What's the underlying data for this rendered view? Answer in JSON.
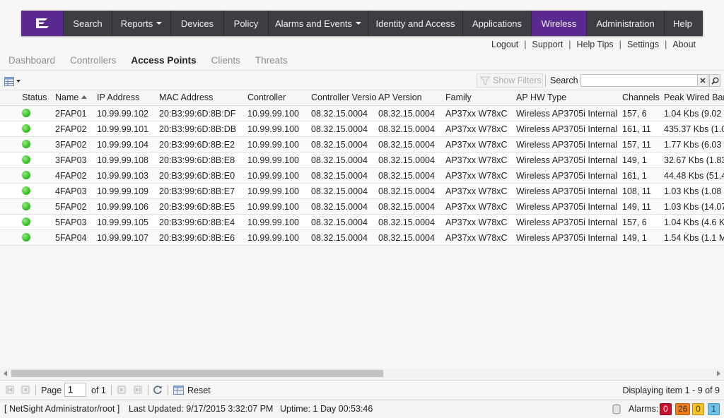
{
  "nav": {
    "items": [
      {
        "label": "Search",
        "caret": false
      },
      {
        "label": "Reports",
        "caret": true
      },
      {
        "label": "Devices",
        "caret": false
      },
      {
        "label": "Policy",
        "caret": false
      },
      {
        "label": "Alarms and Events",
        "caret": true
      },
      {
        "label": "Identity and Access",
        "caret": false
      },
      {
        "label": "Applications",
        "caret": false
      },
      {
        "label": "Wireless",
        "caret": false,
        "active": true
      },
      {
        "label": "Administration",
        "caret": false
      },
      {
        "label": "Help",
        "caret": false
      }
    ],
    "accent": "#5a2a8e"
  },
  "util_links": [
    "Logout",
    "Support",
    "Help Tips",
    "Settings",
    "About"
  ],
  "subtabs": [
    {
      "label": "Dashboard",
      "active": false
    },
    {
      "label": "Controllers",
      "active": false
    },
    {
      "label": "Access Points",
      "active": true
    },
    {
      "label": "Clients",
      "active": false
    },
    {
      "label": "Threats",
      "active": false
    }
  ],
  "toolbar": {
    "show_filters": "Show Filters",
    "search_label": "Search",
    "search_value": ""
  },
  "table": {
    "columns": [
      "Status",
      "Name",
      "IP Address",
      "MAC Address",
      "Controller",
      "Controller Versio",
      "AP Version",
      "Family",
      "AP HW Type",
      "Channels",
      "Peak Wired Band"
    ],
    "rows": [
      {
        "status": "up",
        "name": "2FAP01",
        "ip": "10.99.99.102",
        "mac": "20:B3:99:6D:8B:DF",
        "controller": "10.99.99.100",
        "controller_version": "08.32.15.0004",
        "ap_version": "08.32.15.0004",
        "family": "AP37xx W78xC",
        "hw_type": "Wireless AP3705i Internal",
        "channels": "157, 6",
        "peak": "1.04 Kbs (9.02"
      },
      {
        "status": "up",
        "name": "2FAP02",
        "ip": "10.99.99.101",
        "mac": "20:B3:99:6D:8B:DB",
        "controller": "10.99.99.100",
        "controller_version": "08.32.15.0004",
        "ap_version": "08.32.15.0004",
        "family": "AP37xx W78xC",
        "hw_type": "Wireless AP3705i Internal",
        "channels": "161, 11",
        "peak": "435.37 Kbs (1.0"
      },
      {
        "status": "up",
        "name": "3FAP02",
        "ip": "10.99.99.104",
        "mac": "20:B3:99:6D:8B:E2",
        "controller": "10.99.99.100",
        "controller_version": "08.32.15.0004",
        "ap_version": "08.32.15.0004",
        "family": "AP37xx W78xC",
        "hw_type": "Wireless AP3705i Internal",
        "channels": "157, 11",
        "peak": "1.77 Kbs (6.03"
      },
      {
        "status": "up",
        "name": "3FAP03",
        "ip": "10.99.99.108",
        "mac": "20:B3:99:6D:8B:E8",
        "controller": "10.99.99.100",
        "controller_version": "08.32.15.0004",
        "ap_version": "08.32.15.0004",
        "family": "AP37xx W78xC",
        "hw_type": "Wireless AP3705i Internal",
        "channels": "149, 1",
        "peak": "32.67 Kbs (1.83"
      },
      {
        "status": "up",
        "name": "4FAP02",
        "ip": "10.99.99.103",
        "mac": "20:B3:99:6D:8B:E0",
        "controller": "10.99.99.100",
        "controller_version": "08.32.15.0004",
        "ap_version": "08.32.15.0004",
        "family": "AP37xx W78xC",
        "hw_type": "Wireless AP3705i Internal",
        "channels": "161, 1",
        "peak": "44.48 Kbs (51.4"
      },
      {
        "status": "up",
        "name": "4FAP03",
        "ip": "10.99.99.109",
        "mac": "20:B3:99:6D:8B:E7",
        "controller": "10.99.99.100",
        "controller_version": "08.32.15.0004",
        "ap_version": "08.32.15.0004",
        "family": "AP37xx W78xC",
        "hw_type": "Wireless AP3705i Internal",
        "channels": "108, 11",
        "peak": "1.03 Kbs (1.08"
      },
      {
        "status": "up",
        "name": "5FAP02",
        "ip": "10.99.99.106",
        "mac": "20:B3:99:6D:8B:E5",
        "controller": "10.99.99.100",
        "controller_version": "08.32.15.0004",
        "ap_version": "08.32.15.0004",
        "family": "AP37xx W78xC",
        "hw_type": "Wireless AP3705i Internal",
        "channels": "149, 11",
        "peak": "1.03 Kbs (14.07"
      },
      {
        "status": "up",
        "name": "5FAP03",
        "ip": "10.99.99.105",
        "mac": "20:B3:99:6D:8B:E4",
        "controller": "10.99.99.100",
        "controller_version": "08.32.15.0004",
        "ap_version": "08.32.15.0004",
        "family": "AP37xx W78xC",
        "hw_type": "Wireless AP3705i Internal",
        "channels": "157, 6",
        "peak": "1.04 Kbs (4.6 K"
      },
      {
        "status": "up",
        "name": "5FAP04",
        "ip": "10.99.99.107",
        "mac": "20:B3:99:6D:8B:E6",
        "controller": "10.99.99.100",
        "controller_version": "08.32.15.0004",
        "ap_version": "08.32.15.0004",
        "family": "AP37xx W78xC",
        "hw_type": "Wireless AP3705i Internal",
        "channels": "149, 1",
        "peak": "1.54 Kbs (1.1 M"
      }
    ]
  },
  "paging": {
    "page_label": "Page",
    "page_value": "1",
    "of_label": "of 1",
    "reset_label": "Reset",
    "displaying": "Displaying item 1 - 9 of 9"
  },
  "status_bar": {
    "user": "[ NetSight Administrator/root ]",
    "updated": "Last Updated: 9/17/2015 3:32:07 PM",
    "uptime": "Uptime: 1 Day 00:53:46",
    "alarms_label": "Alarms:",
    "alarms": [
      {
        "count": "0",
        "bg": "#c8102e",
        "fg": "#ffffff",
        "border": "#8e0a1f"
      },
      {
        "count": "26",
        "bg": "#f07d1a",
        "fg": "#333333",
        "border": "#b85a0d"
      },
      {
        "count": "0",
        "bg": "#f7c325",
        "fg": "#333333",
        "border": "#b58c12"
      },
      {
        "count": "1",
        "bg": "#6cc4e8",
        "fg": "#333333",
        "border": "#3a93b8"
      }
    ]
  }
}
